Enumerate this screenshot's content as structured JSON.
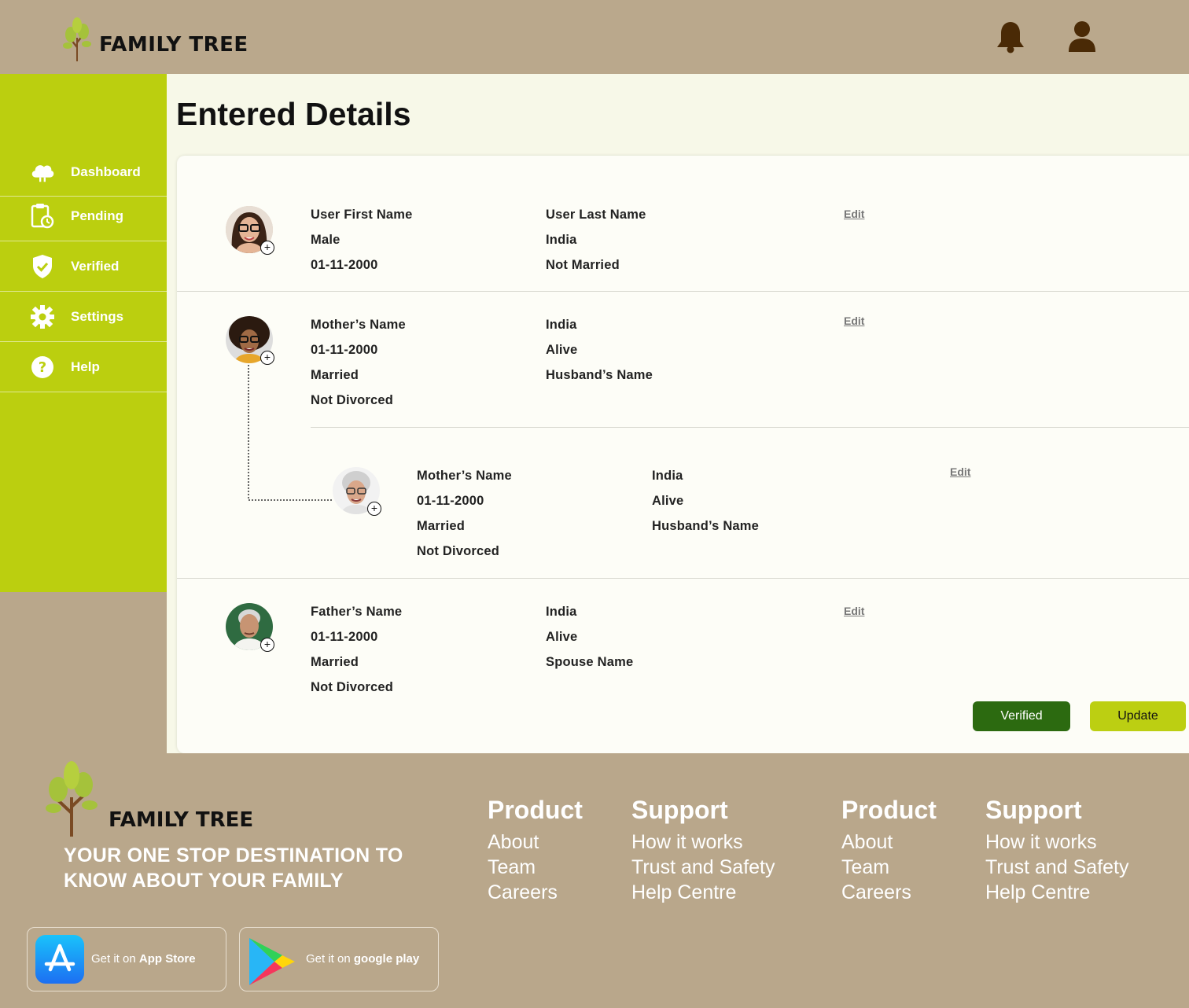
{
  "app": {
    "name": "FAMILY TREE"
  },
  "header": {
    "icons": [
      "bell-icon",
      "user-icon"
    ]
  },
  "sidebar": {
    "items": [
      {
        "label": "Dashboard",
        "icon": "cloud-icon"
      },
      {
        "label": "Pending",
        "icon": "clipboard-clock-icon"
      },
      {
        "label": "Verified",
        "icon": "shield-check-icon"
      },
      {
        "label": "Settings",
        "icon": "gear-icon"
      },
      {
        "label": "Help",
        "icon": "question-icon"
      }
    ]
  },
  "main": {
    "title": "Entered Details",
    "edit_label": "Edit",
    "user": {
      "col1": [
        "User First Name",
        "Male",
        "01-11-2000"
      ],
      "col2": [
        "User Last Name",
        "India",
        "Not Married"
      ]
    },
    "mother": {
      "col1": [
        "Mother’s Name",
        "01-11-2000",
        "Married",
        "Not Divorced"
      ],
      "col2": [
        "India",
        "Alive",
        "Husband’s Name"
      ]
    },
    "grandmother": {
      "col1": [
        "Mother’s Name",
        "01-11-2000",
        "Married",
        "Not Divorced"
      ],
      "col2": [
        "India",
        "Alive",
        "Husband’s Name"
      ]
    },
    "father": {
      "col1": [
        "Father’s Name",
        "01-11-2000",
        "Married",
        "Not Divorced"
      ],
      "col2": [
        "India",
        "Alive",
        "Spouse Name"
      ]
    },
    "buttons": {
      "verified": "Verified",
      "update": "Update"
    }
  },
  "footer": {
    "brand": "FAMILY TREE",
    "tagline_line1": "YOUR ONE STOP DESTINATION TO",
    "tagline_line2": "KNOW ABOUT YOUR FAMILY",
    "columns": [
      {
        "heading": "Product",
        "links": [
          "About",
          "Team",
          "Careers"
        ]
      },
      {
        "heading": "Support",
        "links": [
          "How it works",
          "Trust and Safety",
          "Help Centre"
        ]
      },
      {
        "heading": "Product",
        "links": [
          "About",
          "Team",
          "Careers"
        ]
      },
      {
        "heading": "Support",
        "links": [
          "How it works",
          "Trust and Safety",
          "Help Centre"
        ]
      }
    ],
    "app_store": {
      "prefix": "Get it on",
      "name": "App Store"
    },
    "google_play": {
      "prefix": "Get it on",
      "name": "google play"
    }
  },
  "colors": {
    "header_bg": "#baa88c",
    "sidebar_bg": "#bbcf0f",
    "verified_btn": "#2c6a10",
    "update_btn": "#bccf12"
  }
}
